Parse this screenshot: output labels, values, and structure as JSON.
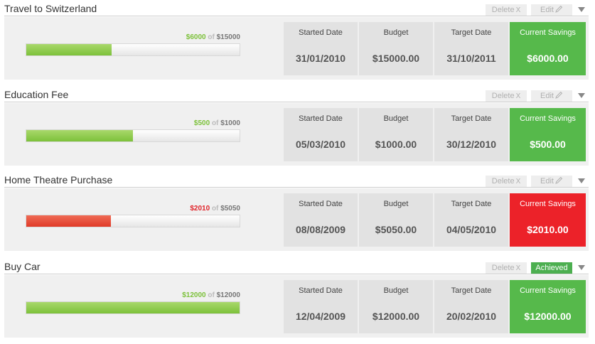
{
  "labels": {
    "delete": "Delete",
    "delete_glyph": "X",
    "edit": "Edit",
    "achieved": "Achieved",
    "of": "of",
    "started": "Started Date",
    "budget": "Budget",
    "target": "Target Date",
    "current": "Current Savings"
  },
  "colors": {
    "green": "#56b94b",
    "red": "#ec2229",
    "green_text": "#7cc13a",
    "red_text": "#e0242a"
  },
  "icons": {
    "edit": "pencil-icon",
    "expand": "triangle-down-icon"
  },
  "goals": [
    {
      "title": "Travel to Switzerland",
      "saved": "$6000",
      "total": "$15000",
      "progress": 0.4,
      "status": "green",
      "started": "31/01/2010",
      "budget": "$15000.00",
      "target": "31/10/2011",
      "current": "$6000.00"
    },
    {
      "title": "Education Fee",
      "saved": "$500",
      "total": "$1000",
      "progress": 0.5,
      "status": "green",
      "started": "05/03/2010",
      "budget": "$1000.00",
      "target": "30/12/2010",
      "current": "$500.00"
    },
    {
      "title": "Home Theatre Purchase",
      "saved": "$2010",
      "total": "$5050",
      "progress": 0.398,
      "status": "red",
      "started": "08/08/2009",
      "budget": "$5050.00",
      "target": "04/05/2010",
      "current": "$2010.00"
    },
    {
      "title": "Buy Car",
      "saved": "$12000",
      "total": "$12000",
      "progress": 1.0,
      "status": "green",
      "achieved": true,
      "started": "12/04/2009",
      "budget": "$12000.00",
      "target": "20/02/2010",
      "current": "$12000.00"
    }
  ]
}
